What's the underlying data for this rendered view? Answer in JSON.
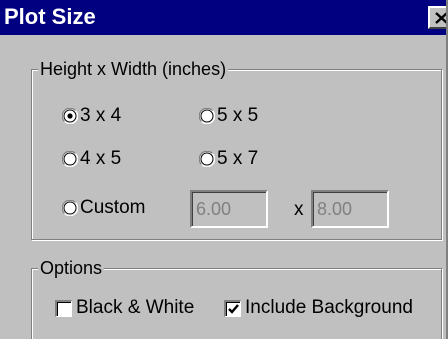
{
  "window": {
    "title": "Plot Size",
    "close_glyph": "X"
  },
  "size_group": {
    "label": "Height x Width (inches)",
    "options": [
      {
        "label": "3 x 4",
        "selected": true
      },
      {
        "label": "5 x 5",
        "selected": false
      },
      {
        "label": "4 x 5",
        "selected": false
      },
      {
        "label": "5 x 7",
        "selected": false
      },
      {
        "label": "Custom",
        "selected": false
      }
    ],
    "custom": {
      "height_value": "6.00",
      "separator": "x",
      "width_value": "8.00",
      "disabled": true
    }
  },
  "options_group": {
    "label": "Options",
    "black_white": {
      "label": "Black & White",
      "checked": false
    },
    "include_background": {
      "label": "Include Background",
      "checked": true
    }
  },
  "colors": {
    "title_bar": "#000080",
    "dialog_face": "#c0c0c0",
    "disabled_text": "#808080"
  }
}
